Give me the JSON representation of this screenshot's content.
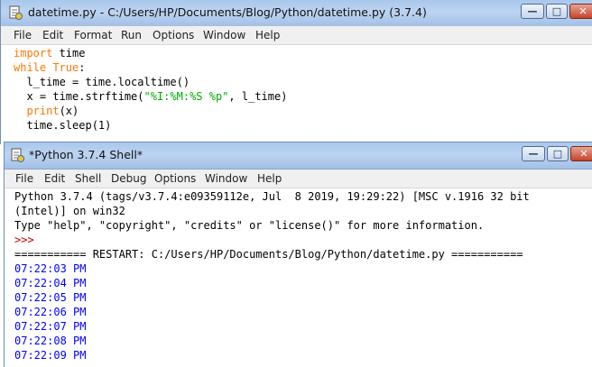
{
  "editor": {
    "title": "datetime.py - C:/Users/HP/Documents/Blog/Python/datetime.py (3.7.4)",
    "menu": [
      "File",
      "Edit",
      "Format",
      "Run",
      "Options",
      "Window",
      "Help"
    ],
    "code": {
      "l1_kw": "import",
      "l1_rest": " time",
      "l2_kw": "while",
      "l2_kw2": " True",
      "l2_rest": ":",
      "l3": "  l_time = time.localtime()",
      "l4_a": "  x = time.strftime(",
      "l4_str": "\"%I:%M:%S %p\"",
      "l4_b": ", l_time)",
      "l5_kw": "  print",
      "l5_rest": "(x)",
      "l6": "  time.sleep(1)"
    }
  },
  "shell": {
    "title": "*Python 3.7.4 Shell*",
    "menu": [
      "File",
      "Edit",
      "Shell",
      "Debug",
      "Options",
      "Window",
      "Help"
    ],
    "banner_1": "Python 3.7.4 (tags/v3.7.4:e09359112e, Jul  8 2019, 19:29:22) [MSC v.1916 32 bit",
    "banner_2": "(Intel)] on win32",
    "banner_3": "Type \"help\", \"copyright\", \"credits\" or \"license()\" for more information.",
    "prompt": ">>>",
    "restart_line": "=========== RESTART: C:/Users/HP/Documents/Blog/Python/datetime.py ===========",
    "outputs": [
      "07:22:03 PM",
      "07:22:04 PM",
      "07:22:05 PM",
      "07:22:06 PM",
      "07:22:07 PM",
      "07:22:08 PM",
      "07:22:09 PM"
    ]
  },
  "colors": {
    "keyword": "#ff7700",
    "string": "#00aa00",
    "output": "#0000ff",
    "prompt": "#c00000"
  },
  "icons": {
    "app_icon": "python-idle-icon",
    "minimize": "minimize-icon",
    "maximize": "maximize-icon",
    "close": "close-icon"
  }
}
